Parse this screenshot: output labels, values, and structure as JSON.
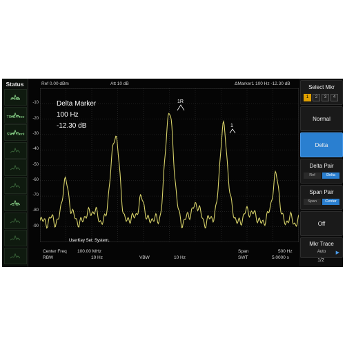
{
  "status": {
    "title": "Status",
    "items": [
      {
        "label": "Peak",
        "icon": "peak-detector-icon",
        "dim": false
      },
      {
        "label": "TRIG Free",
        "icon": "trigger-icon",
        "dim": false
      },
      {
        "label": "SWP Cont",
        "icon": "sweep-icon",
        "dim": false
      },
      {
        "label": "",
        "icon": "trace-icon",
        "dim": true
      },
      {
        "label": "",
        "icon": "trace-icon",
        "dim": true
      },
      {
        "label": "",
        "icon": "trace-icon",
        "dim": true
      },
      {
        "label": "C.W.",
        "icon": "cw-icon",
        "dim": false
      },
      {
        "label": "",
        "icon": "trace-icon",
        "dim": true
      },
      {
        "label": "",
        "icon": "trace-icon",
        "dim": true
      },
      {
        "label": "",
        "icon": "trace-icon",
        "dim": true
      }
    ]
  },
  "topbar": {
    "ref": "Ref  0.00 dBm",
    "att": "Att    10 dB",
    "marker": "ΔMarker1   100 Hz   -12.30 dB"
  },
  "annotation": {
    "line1": "Delta Marker",
    "line2": "100 Hz",
    "line3": "-12.30 dB"
  },
  "y_axis": {
    "ticks": [
      "-10",
      "-20",
      "-30",
      "-40",
      "-50",
      "-60",
      "-70",
      "-80",
      "-90"
    ]
  },
  "markers": {
    "ref_label": "1R",
    "delta_label": "1"
  },
  "userkey": "UserKey Set:    System,",
  "bottombar": {
    "center_freq_label": "Center Freq",
    "center_freq_value": "100.00 MHz",
    "span_label": "Span",
    "span_value": "500 Hz",
    "rbw_label": "RBW",
    "rbw_value": "10 Hz",
    "vbw_label": "VBW",
    "vbw_value": "10 Hz",
    "swt_label": "SWT",
    "swt_value": "5.0000 s"
  },
  "menu": {
    "select_mkr": {
      "title": "Select Mkr",
      "boxes": [
        "1",
        "2",
        "3",
        "4"
      ]
    },
    "normal": "Normal",
    "delta": "Delta",
    "delta_pair": {
      "title": "Delta Pair",
      "opt1": "Ref",
      "opt2": "Delta"
    },
    "span_pair": {
      "title": "Span Pair",
      "opt1": "Span",
      "opt2": "Center"
    },
    "off": "Off",
    "mkr_trace": {
      "title": "Mkr Trace",
      "value": "Auto"
    },
    "page": "1/2"
  },
  "colors": {
    "trace": "#d8d36a",
    "active_menu": "#2a7fd0",
    "status_text": "#8fdc8f"
  }
}
